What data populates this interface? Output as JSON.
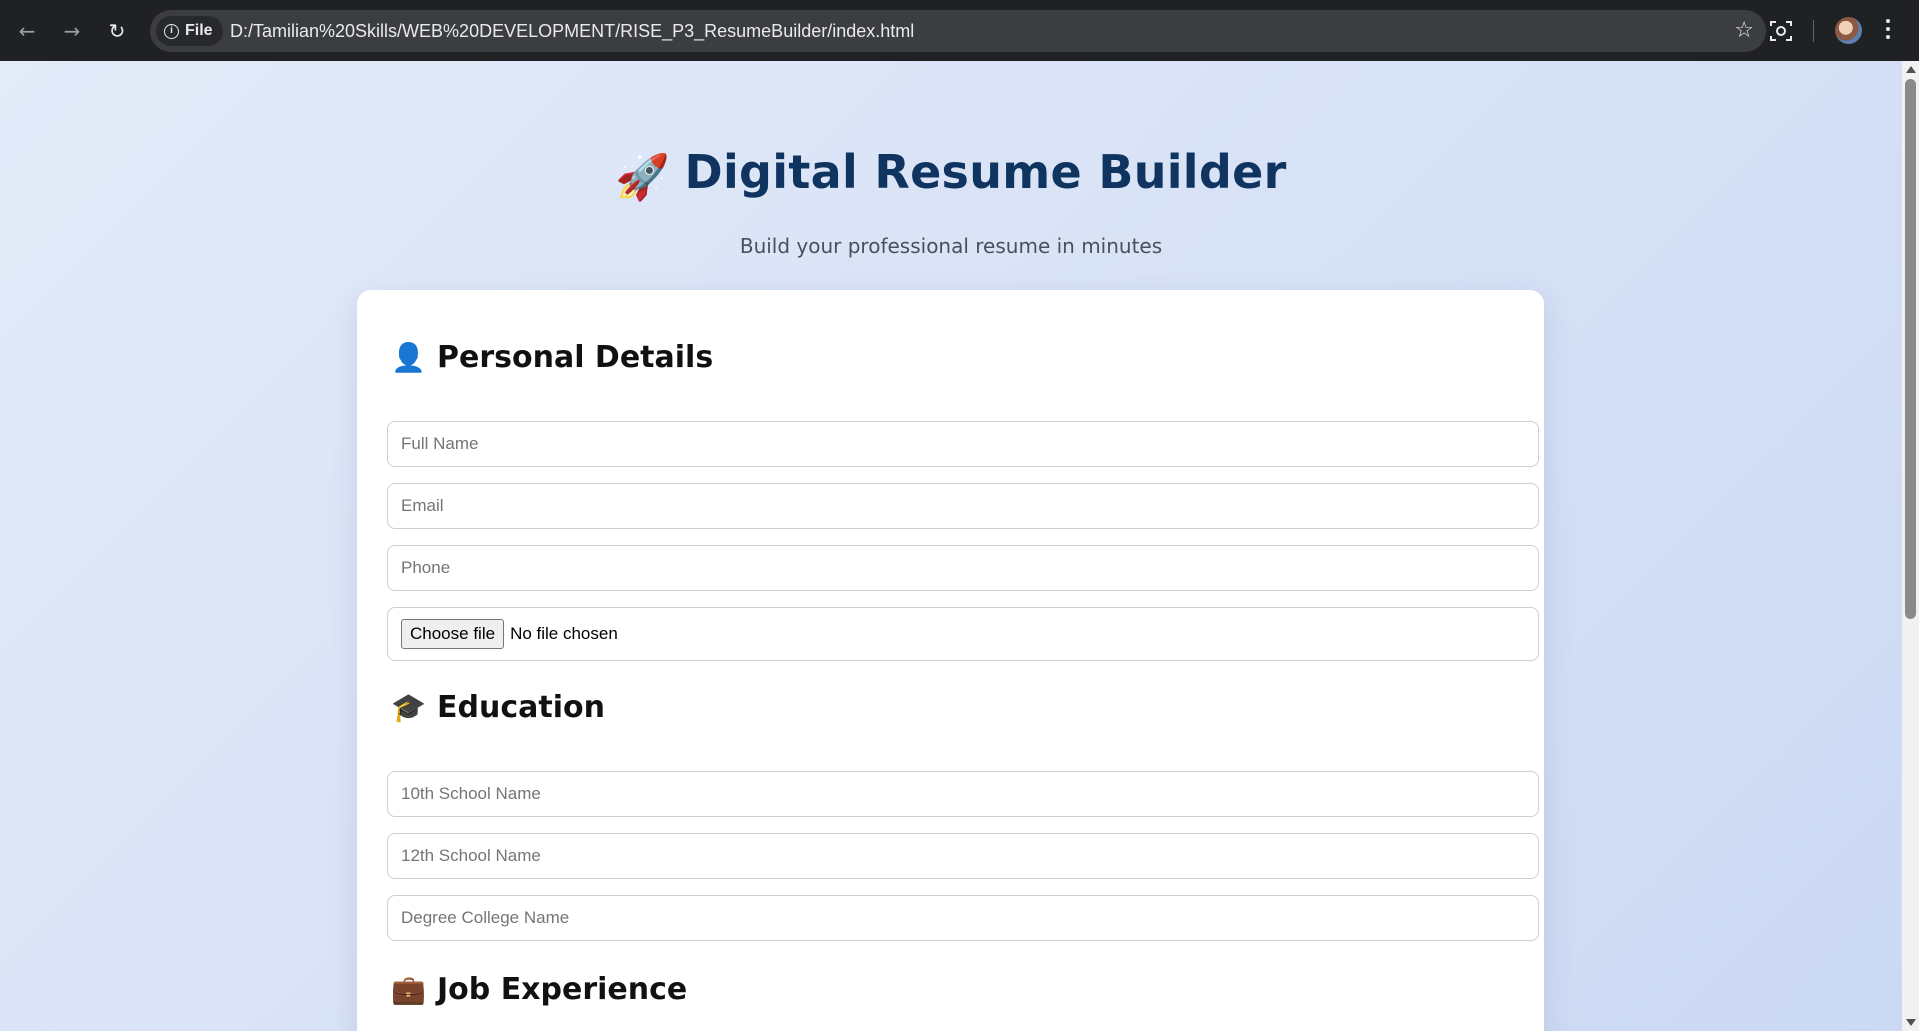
{
  "browser": {
    "site_chip_label": "File",
    "url": "D:/Tamilian%20Skills/WEB%20DEVELOPMENT/RISE_P3_ResumeBuilder/index.html",
    "icons": [
      "back-arrow-icon",
      "forward-arrow-icon",
      "reload-icon",
      "info-icon",
      "star-icon",
      "lens-icon",
      "profile-avatar",
      "kebab-menu-icon"
    ]
  },
  "header": {
    "title": "Digital Resume Builder",
    "subtitle": "Build your professional resume in minutes",
    "title_color": "#0f3460"
  },
  "sections": {
    "personal": {
      "title": "Personal Details",
      "full_name_placeholder": "Full Name",
      "email_placeholder": "Email",
      "phone_placeholder": "Phone",
      "file_button_label": "Choose file",
      "file_status": "No file chosen"
    },
    "education": {
      "title": "Education",
      "school10_placeholder": "10th School Name",
      "school12_placeholder": "12th School Name",
      "college_placeholder": "Degree College Name"
    },
    "experience": {
      "title": "Job Experience"
    }
  },
  "colors": {
    "chrome_bg": "#202124",
    "page_bg": "#dbe4f7",
    "card_bg": "#ffffff"
  }
}
